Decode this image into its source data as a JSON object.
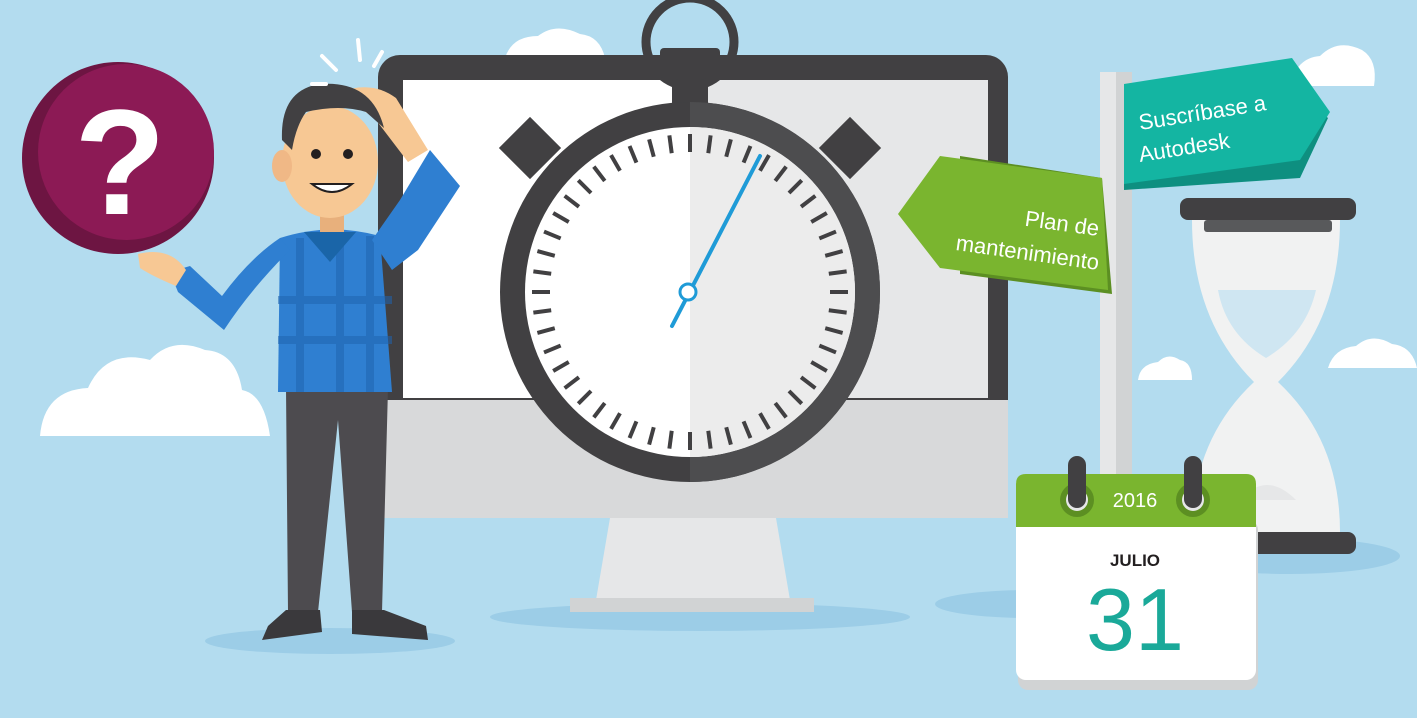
{
  "signpost": {
    "maintenance_line1": "Plan de",
    "maintenance_line2": "mantenimiento",
    "subscription_line1": "Suscríbase a",
    "subscription_line2": "Autodesk"
  },
  "calendar": {
    "year": "2016",
    "month": "JULIO",
    "day": "31"
  },
  "question_badge": {
    "symbol": "?"
  },
  "colors": {
    "sky": "#b3dcef",
    "cloud": "#ffffff",
    "magenta": "#8c1a55",
    "sign_green": "#7ab52f",
    "sign_teal": "#14b5a2",
    "calendar_green": "#7ab52f",
    "date_teal": "#1aa999",
    "shirt_blue": "#2f7fd1",
    "stopwatch_dark": "#414042",
    "second_hand": "#1f9bd7"
  }
}
